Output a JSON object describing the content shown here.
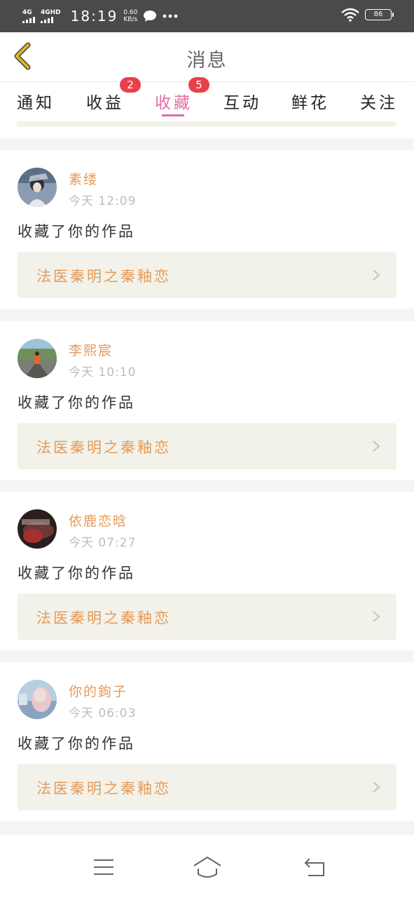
{
  "status_bar": {
    "signal1_label": "4G",
    "signal2_label": "4GHD",
    "time": "18:19",
    "speed_value": "0.60",
    "speed_unit": "KB/s",
    "battery": "86"
  },
  "header": {
    "title": "消息",
    "back_icon": "chevron-left-icon",
    "back_color": "#e0b820"
  },
  "tabs": [
    {
      "label": "通知"
    },
    {
      "label": "收益",
      "badge": "2"
    },
    {
      "label": "收藏",
      "badge": "5",
      "active": true
    },
    {
      "label": "互动"
    },
    {
      "label": "鲜花"
    },
    {
      "label": "关注"
    }
  ],
  "colors": {
    "accent": "#e26fa4",
    "name": "#e79a58",
    "badge": "#e9414b",
    "work_bg": "#f2f2ea"
  },
  "items": [
    {
      "name": "素缕",
      "time": "今天 12:09",
      "action": "收藏了你的作品",
      "work_title": "法医秦明之秦釉恋"
    },
    {
      "name": "李熙宸",
      "time": "今天 10:10",
      "action": "收藏了你的作品",
      "work_title": "法医秦明之秦釉恋"
    },
    {
      "name": "依鹿恋晗",
      "time": "今天 07:27",
      "action": "收藏了你的作品",
      "work_title": "法医秦明之秦釉恋"
    },
    {
      "name": "你的鉤子",
      "time": "今天 06:03",
      "action": "收藏了你的作品",
      "work_title": "法医秦明之秦釉恋"
    }
  ],
  "nav": {
    "menu_icon": "menu-icon",
    "home_icon": "home-icon",
    "back_icon": "back-icon"
  }
}
